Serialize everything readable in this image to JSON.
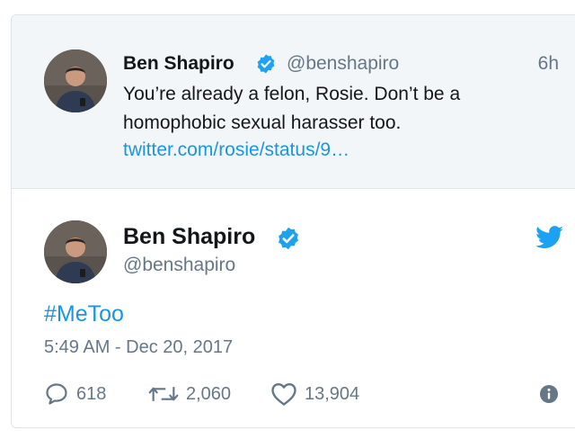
{
  "quoted": {
    "name": "Ben Shapiro",
    "handle": "@benshapiro",
    "time": "6h",
    "text": "You’re already a felon, Rosie. Don’t be a homophobic sexual harasser too.",
    "link": "twitter.com/rosie/status/9…"
  },
  "main": {
    "name": "Ben Shapiro",
    "handle": "@benshapiro",
    "hashtag": "#MeToo",
    "datetime": "5:49 AM - Dec 20, 2017"
  },
  "actions": {
    "replies": "618",
    "retweets": "2,060",
    "likes": "13,904"
  },
  "icons": {
    "verified": "verified-badge-icon",
    "brand": "twitter-bird-icon",
    "reply": "reply-icon",
    "retweet": "retweet-icon",
    "like": "heart-icon",
    "info": "info-icon"
  },
  "colors": {
    "link": "#1b95e0",
    "secondary_text": "#657786",
    "quoted_bg": "#f3f6f9"
  }
}
